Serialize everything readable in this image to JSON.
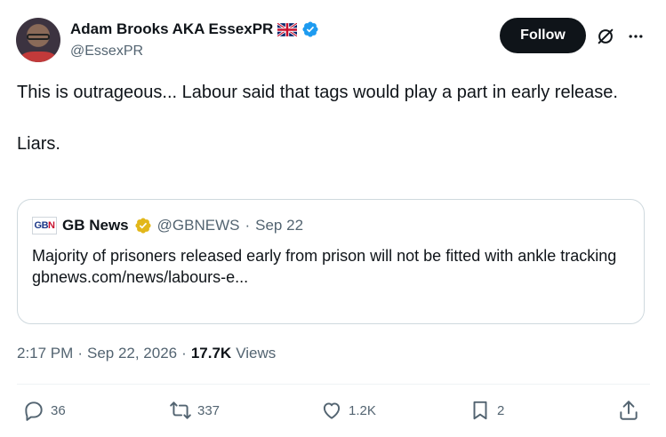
{
  "author": {
    "display_name": "Adam Brooks AKA EssexPR",
    "handle": "@EssexPR",
    "avatar_icon": "profile-photo",
    "verified_color": "#1d9bf0"
  },
  "header": {
    "follow_label": "Follow",
    "grok_icon": "grok-icon",
    "more_icon": "more-icon"
  },
  "tweet": {
    "text_line1": "This is outrageous... Labour said that tags would play a part in early release.",
    "text_line2": "Liars."
  },
  "quote": {
    "name": "GB News",
    "logo_text_a": "GB",
    "logo_text_b": "N",
    "handle": "@GBNEWS",
    "dot": "·",
    "date": "Sep 22",
    "text": "Majority of prisoners released early from prison will not be fitted with ankle tracking",
    "link": "gbnews.com/news/labours-e...",
    "badge_color": "#e2b719"
  },
  "meta": {
    "time": "2:17 PM",
    "dot1": "·",
    "date": "Sep 22, 2026",
    "dot2": "·",
    "views_count": "17.7K",
    "views_label": "Views"
  },
  "actions": {
    "replies": "36",
    "reposts": "337",
    "likes": "1.2K",
    "bookmarks": "2"
  }
}
